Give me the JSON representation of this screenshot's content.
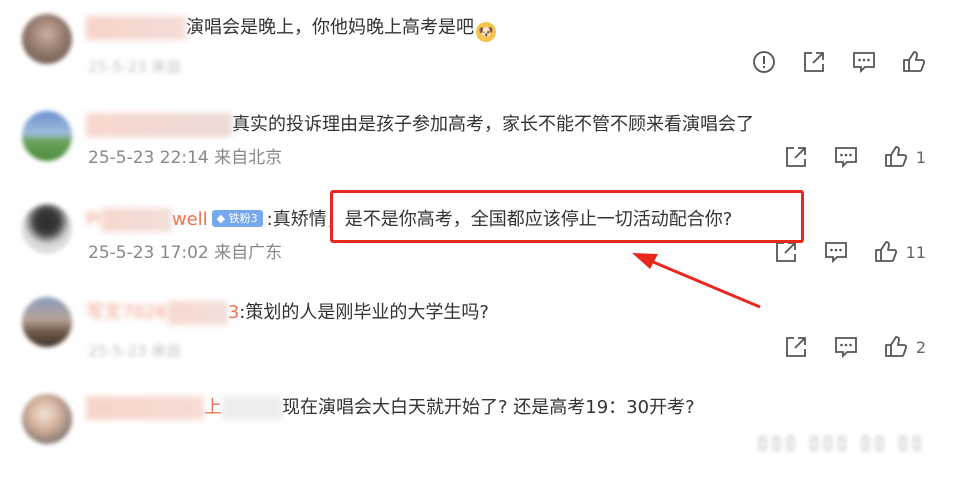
{
  "comments": [
    {
      "username": "x",
      "text": "演唱会是晚上，你他妈晚上高考是吧",
      "meta": "25-5-23 来自",
      "like_count": ""
    },
    {
      "username": "阿",
      "text": "真实的投诉理由是孩子参加高考，家长不能不管不顾来看演唱会了",
      "meta": "25-5-23 22:14 来自北京",
      "like_count": "1"
    },
    {
      "username_prefix": "Pl",
      "username_suffix": "well",
      "badge": "铁粉3",
      "text_prefix": ":真矫情，",
      "text": "是不是你高考，全国都应该停止一切活动配合你?",
      "meta": "25-5-23 17:02 来自广东",
      "like_count": "11"
    },
    {
      "username": "写文7026",
      "username_tail": "3",
      "text": ":策划的人是刚毕业的大学生吗?",
      "meta": "25-5-23 来自",
      "like_count": "2"
    },
    {
      "username": "上",
      "text": "现在演唱会大白天就开始了? 还是高考19：30开考?",
      "meta": "",
      "like_count": ""
    }
  ],
  "colors": {
    "username": "#eb7350",
    "highlight": "#e8281f",
    "badge": "#76a9ee"
  },
  "icons": [
    "report-icon",
    "forward-icon",
    "comment-icon",
    "like-icon"
  ]
}
